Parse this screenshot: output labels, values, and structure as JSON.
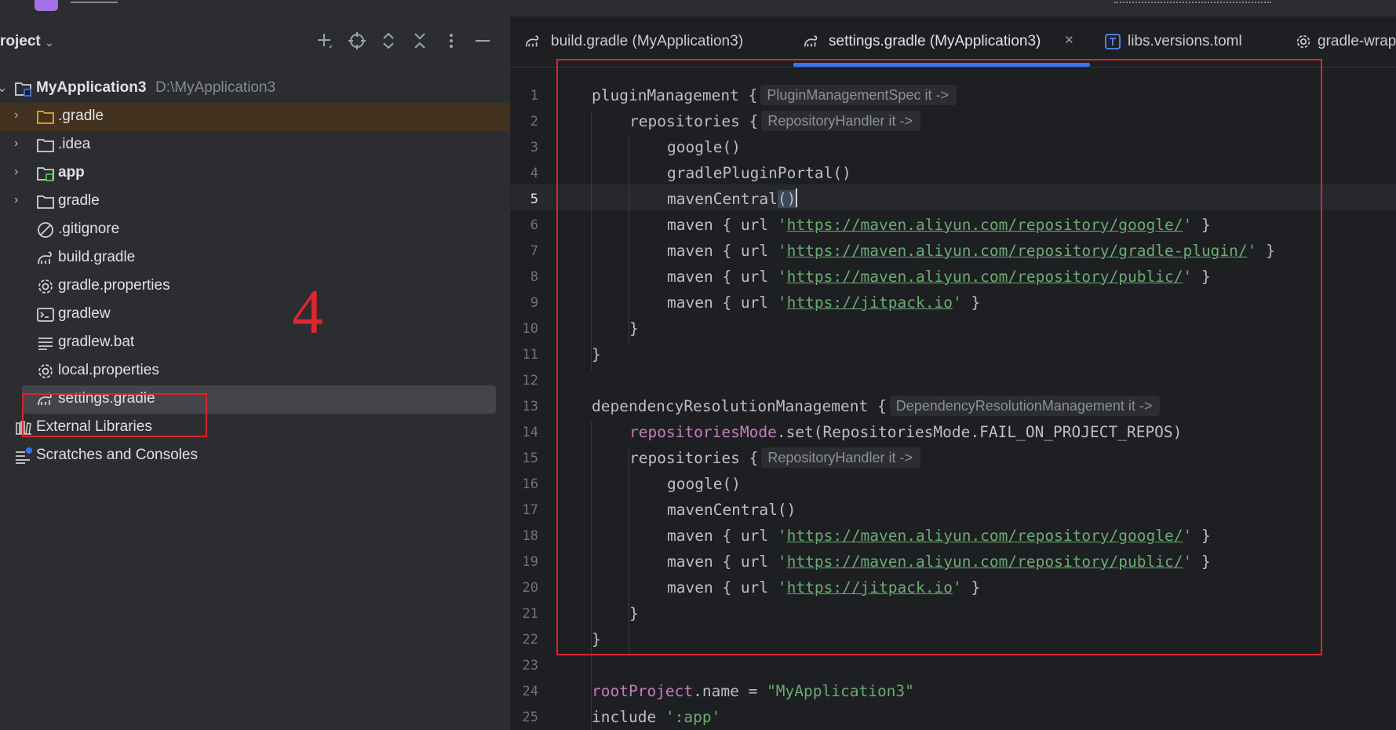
{
  "project_panel": {
    "title": "roject",
    "tree": [
      {
        "label": "MyApplication3",
        "path": "D:\\MyApplication3",
        "icon": "module-folder-icon",
        "expanded": true
      },
      {
        "label": ".gradle",
        "icon": "folder-icon-orange",
        "expandable": true
      },
      {
        "label": ".idea",
        "icon": "folder-icon",
        "expandable": true
      },
      {
        "label": "app",
        "icon": "module-folder-icon",
        "expandable": true
      },
      {
        "label": "gradle",
        "icon": "folder-icon",
        "expandable": true
      },
      {
        "label": ".gitignore",
        "icon": "ignore-file-icon"
      },
      {
        "label": "build.gradle",
        "icon": "gradle-elephant-icon"
      },
      {
        "label": "gradle.properties",
        "icon": "gear-icon"
      },
      {
        "label": "gradlew",
        "icon": "terminal-icon"
      },
      {
        "label": "gradlew.bat",
        "icon": "text-lines-icon"
      },
      {
        "label": "local.properties",
        "icon": "gear-icon"
      },
      {
        "label": "settings.gradle",
        "icon": "gradle-elephant-icon",
        "selected": true
      },
      {
        "label": "External Libraries",
        "icon": "libraries-icon",
        "expandable": true
      },
      {
        "label": "Scratches and Consoles",
        "icon": "scratches-icon"
      }
    ]
  },
  "annotation": "4",
  "tabs": [
    {
      "label": "build.gradle (MyApplication3)",
      "icon": "gradle-elephant-icon"
    },
    {
      "label": "settings.gradle (MyApplication3)",
      "icon": "gradle-elephant-icon",
      "active": true,
      "close": "×"
    },
    {
      "label": "libs.versions.toml",
      "icon": "toml-file-icon"
    },
    {
      "label": "gradle-wrap",
      "icon": "gear-icon"
    }
  ],
  "editor": {
    "current_line": 5,
    "lines": {
      "l1": {
        "no": "1",
        "text": "pluginManagement {",
        "hint": "PluginManagementSpec it ->"
      },
      "l2": {
        "no": "2",
        "text": "repositories {",
        "hint": "RepositoryHandler it ->"
      },
      "l3": {
        "no": "3",
        "text": "google()"
      },
      "l4": {
        "no": "4",
        "text": "gradlePluginPortal()"
      },
      "l5": {
        "no": "5",
        "text": "mavenCentral",
        "paren": "()"
      },
      "l6": {
        "no": "6",
        "pre": "maven { url ",
        "url": "https://maven.aliyun.com/repository/google/",
        "post": " }"
      },
      "l7": {
        "no": "7",
        "pre": "maven { url ",
        "url": "https://maven.aliyun.com/repository/gradle-plugin/",
        "post": " }"
      },
      "l8": {
        "no": "8",
        "pre": "maven { url ",
        "url": "https://maven.aliyun.com/repository/public/",
        "post": " }"
      },
      "l9": {
        "no": "9",
        "pre": "maven { url ",
        "url": "https://jitpack.io",
        "post": " }"
      },
      "l10": {
        "no": "10",
        "text": "}"
      },
      "l11": {
        "no": "11",
        "text": "}"
      },
      "l12": {
        "no": "12",
        "text": ""
      },
      "l13": {
        "no": "13",
        "text": "dependencyResolutionManagement {",
        "hint": "DependencyResolutionManagement it ->"
      },
      "l14": {
        "no": "14",
        "prop": "repositoriesMode",
        "rest": ".set(RepositoriesMode.FAIL_ON_PROJECT_REPOS)"
      },
      "l15": {
        "no": "15",
        "text": "repositories {",
        "hint": "RepositoryHandler it ->"
      },
      "l16": {
        "no": "16",
        "text": "google()"
      },
      "l17": {
        "no": "17",
        "text": "mavenCentral()"
      },
      "l18": {
        "no": "18",
        "pre": "maven { url ",
        "url": "https://maven.aliyun.com/repository/google/",
        "post": " }"
      },
      "l19": {
        "no": "19",
        "pre": "maven { url ",
        "url": "https://maven.aliyun.com/repository/public/",
        "post": " }"
      },
      "l20": {
        "no": "20",
        "pre": "maven { url ",
        "url": "https://jitpack.io",
        "post": " }"
      },
      "l21": {
        "no": "21",
        "text": "}"
      },
      "l22": {
        "no": "22",
        "text": "}"
      },
      "l23": {
        "no": "23",
        "text": ""
      },
      "l24": {
        "no": "24",
        "prop": "rootProject",
        "rest": ".name = ",
        "str": "\"MyApplication3\""
      },
      "l25": {
        "no": "25",
        "text": "include ",
        "str": "':app'"
      }
    }
  },
  "colors": {
    "accent": "#3574f0",
    "annotation_red": "#d9262c",
    "string_green": "#6aab73",
    "property_purple": "#c77dbb"
  }
}
